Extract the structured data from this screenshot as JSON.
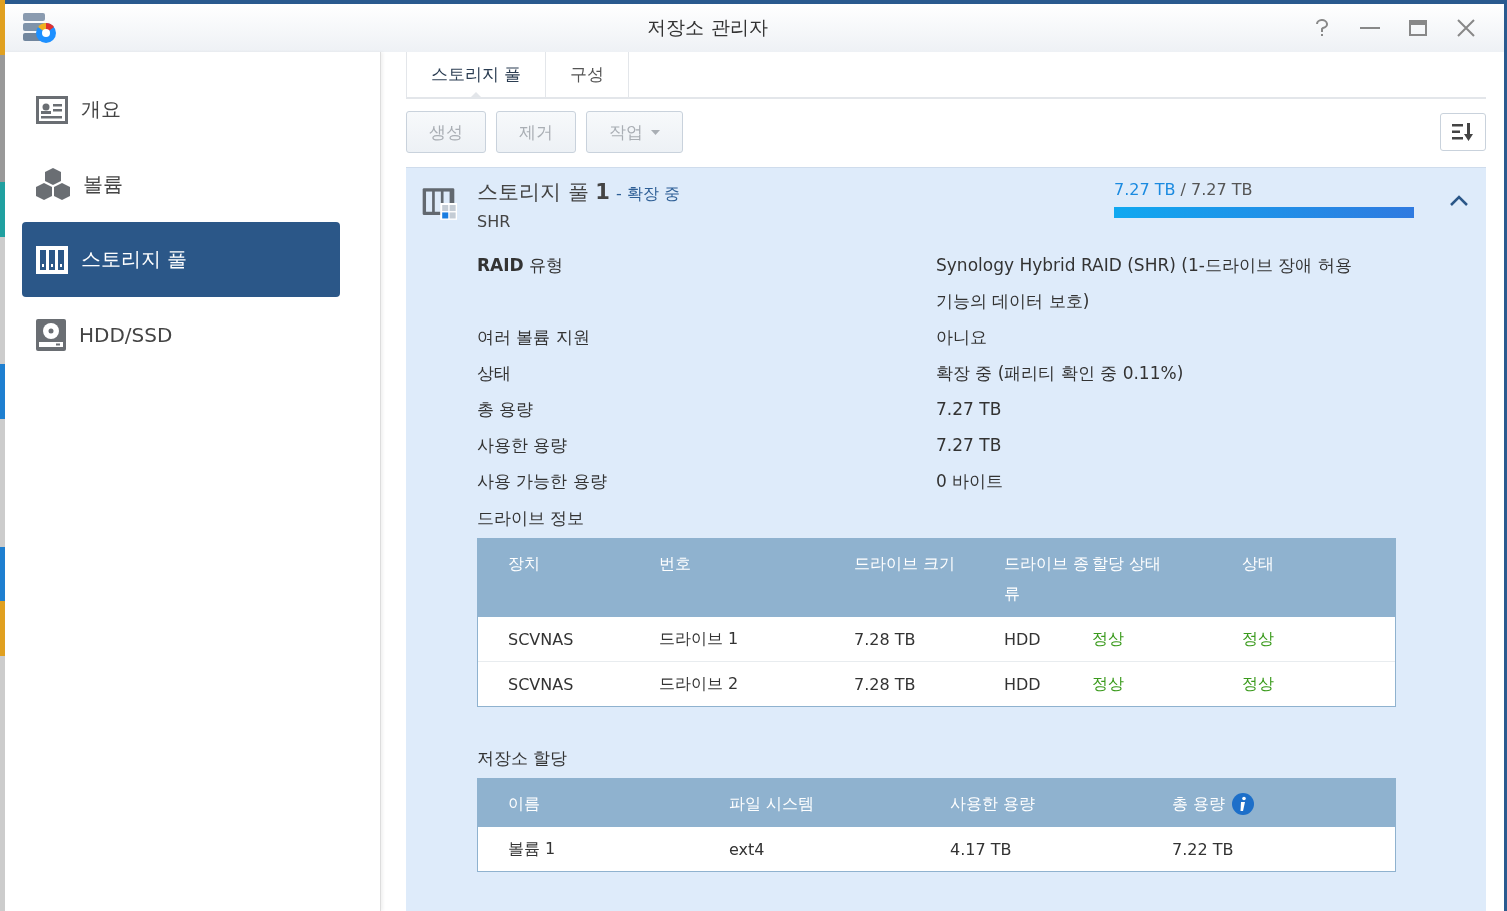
{
  "window": {
    "title": "저장소 관리자"
  },
  "sidebar": {
    "items": [
      {
        "label": "개요",
        "selected": false
      },
      {
        "label": "볼륨",
        "selected": false
      },
      {
        "label": "스토리지 풀",
        "selected": true
      },
      {
        "label": "HDD/SSD",
        "selected": false
      }
    ]
  },
  "tabs": [
    {
      "label": "스토리지 풀",
      "selected": true
    },
    {
      "label": "구성",
      "selected": false
    }
  ],
  "toolbar": {
    "buttons": [
      {
        "label": "생성",
        "dropdown": false
      },
      {
        "label": "제거",
        "dropdown": false
      },
      {
        "label": "작업",
        "dropdown": true
      }
    ]
  },
  "pool": {
    "name": "스토리지 풀 ",
    "number": "1",
    "status": "- 확장 중",
    "raid": "SHR",
    "used": "7.27 TB",
    "total": "/ 7.27 TB",
    "level": 1.0,
    "expanded": true,
    "details": [
      {
        "label": "**RAID** 유형",
        "value": "Synology Hybrid RAID (SHR) (1-드라이브 장애 허용 기능의 데이터 보호)"
      },
      {
        "label": "여러 볼륨 지원",
        "value": "아니요"
      },
      {
        "label": "상태",
        "value": "확장 중 (패리티 확인 중 0.11%)"
      },
      {
        "label": "총 용량",
        "value": "7.27 TB"
      },
      {
        "label": "사용한 용량",
        "value": "7.27 TB"
      },
      {
        "label": "사용 가능한 용량",
        "value": "0 바이트"
      }
    ],
    "drive_info": {
      "title": "드라이브 정보",
      "columns": [
        "장치",
        "번호",
        "드라이브 크기",
        "드라이브 종류",
        "할당 상태",
        "상태"
      ],
      "rows": [
        [
          "SCVNAS",
          "드라이브 1",
          "7.28 TB",
          "HDD",
          "정상",
          "정상"
        ],
        [
          "SCVNAS",
          "드라이브 2",
          "7.28 TB",
          "HDD",
          "정상",
          "정상"
        ]
      ]
    },
    "allocation": {
      "title": "저장소 할당",
      "columns": [
        "이름",
        "파일 시스템",
        "사용한 용량",
        "총 용량"
      ],
      "rows": [
        [
          "볼륨 1",
          "ext4",
          "4.17 TB",
          "7.22 TB"
        ]
      ]
    }
  }
}
